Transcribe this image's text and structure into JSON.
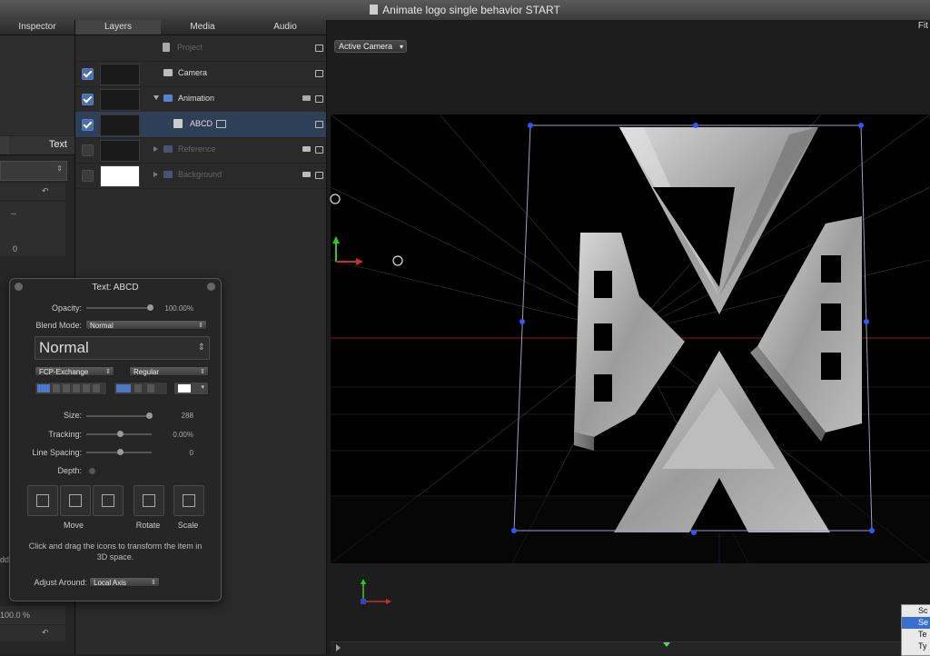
{
  "window": {
    "title": "Animate logo single behavior START"
  },
  "inspector": {
    "tab": "Inspector",
    "subtab": "Text",
    "values": [
      "--",
      "0",
      "100.0 %"
    ],
    "partial_label": "dd"
  },
  "layers_panel": {
    "tabs": [
      "Layers",
      "Media",
      "Audio"
    ],
    "rows": [
      {
        "name": "Project",
        "checked": false,
        "dim": true
      },
      {
        "name": "Camera",
        "checked": true,
        "dim": false
      },
      {
        "name": "Animation",
        "checked": true,
        "dim": false
      },
      {
        "name": "ABCD",
        "checked": true,
        "dim": false
      },
      {
        "name": "Reference",
        "checked": false,
        "dim": true
      },
      {
        "name": "Background",
        "checked": false,
        "dim": true
      }
    ]
  },
  "hud": {
    "title": "Text: ABCD",
    "opacity_label": "Opacity:",
    "opacity_value": "100.00%",
    "opacity_level": 1.0,
    "blend_label": "Blend Mode:",
    "blend_value": "Normal",
    "style_value": "Normal",
    "font_family": "FCP-Exchange",
    "font_weight": "Regular",
    "size_label": "Size:",
    "size_value": "288",
    "tracking_label": "Tracking:",
    "tracking_value": "0.00%",
    "line_spacing_label": "Line Spacing:",
    "line_spacing_value": "0",
    "depth_label": "Depth:",
    "move_label": "Move",
    "rotate_label": "Rotate",
    "scale_label": "Scale",
    "help_text": "Click and drag the icons to transform the item in 3D space.",
    "adjust_label": "Adjust Around:",
    "adjust_value": "Local Axis"
  },
  "canvas": {
    "camera_popup": "Active Camera",
    "view_menu": "Fit",
    "menu_items": [
      "Sc",
      "Se",
      "Te",
      "Ty"
    ],
    "menu_selected_index": 1
  },
  "colors": {
    "selection": "#2f3f57",
    "accent": "#4d6fa8",
    "bounding_box": "#3355ff"
  }
}
